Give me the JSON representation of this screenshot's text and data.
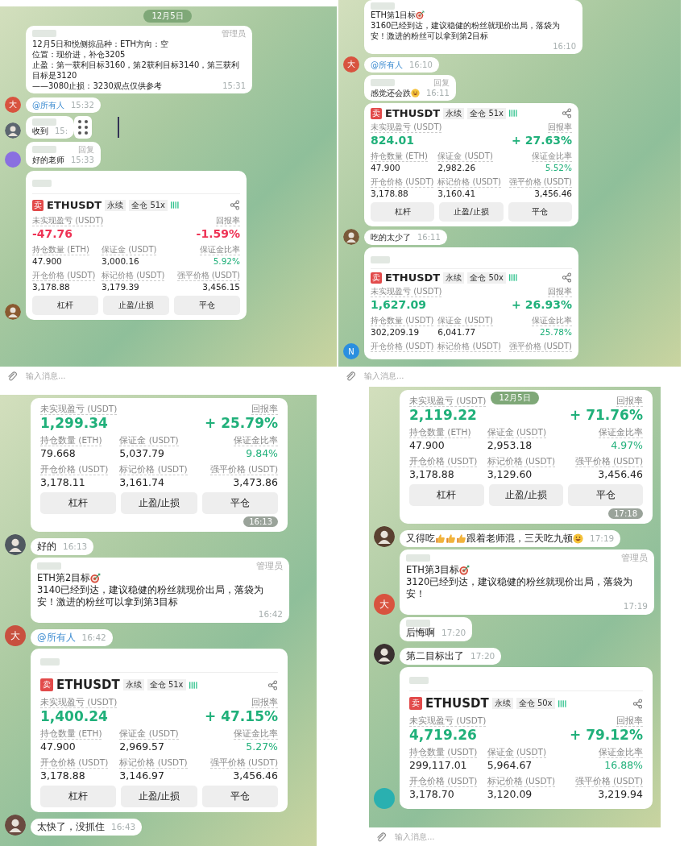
{
  "panels": [
    {
      "items": [
        {
          "kind": "date",
          "text": "12月5日"
        },
        {
          "kind": "message",
          "sender_hidden": true,
          "tag": "管理员",
          "paragraphs": [
            "12月5日和悦侧掠",
            "品种：ETH",
            "方向：空",
            "位置：现价进，补仓3205",
            "止盈：第一获利目标3160，第2获利目标3140，第三获利目标是3120",
            "——3080",
            "止损：3230",
            "观点仅供参考"
          ],
          "time": "15:31"
        },
        {
          "kind": "message",
          "avatar": {
            "kind": "letter",
            "text": "大",
            "color": "#d8533f"
          },
          "mention": true,
          "paragraphs": [
            "@所有人"
          ],
          "time": "15:32"
        },
        {
          "kind": "message",
          "avatar": {
            "kind": "photo",
            "color": "#5c6670"
          },
          "sender_hidden": true,
          "paragraphs": [
            "收到"
          ],
          "time": "15:",
          "handle": true
        },
        {
          "kind": "message",
          "avatar": {
            "kind": "plain",
            "color": "#8a6fe0"
          },
          "sender_hidden": true,
          "tag": "回复",
          "paragraphs": [
            "好的老师"
          ],
          "time": "15:33"
        },
        {
          "kind": "card",
          "avatar": {
            "kind": "photo",
            "color": "#8a5a30"
          },
          "name_hidden": true,
          "side": "卖",
          "symbol": "ETHUSDT",
          "tags": [
            "永续",
            "全仓 51x"
          ],
          "rows": [
            {
              "big": true,
              "cells": [
                {
                  "label": "未实现盈亏 (USDT)",
                  "value": "-47.76",
                  "color": "#ee3355"
                },
                null,
                {
                  "label": "回报率",
                  "value": "-1.59%",
                  "color": "#ee3355"
                }
              ]
            },
            {
              "cells": [
                {
                  "label": "持仓数量 (ETH)",
                  "value": "47.900"
                },
                {
                  "label": "保证金 (USDT)",
                  "value": "3,000.16"
                },
                {
                  "label": "保证金比率",
                  "value": "5.92%",
                  "color": "#20b07a"
                }
              ]
            },
            {
              "cells": [
                {
                  "label": "开仓价格 (USDT)",
                  "value": "3,178.88"
                },
                {
                  "label": "标记价格 (USDT)",
                  "value": "3,179.39"
                },
                {
                  "label": "强平价格 (USDT)",
                  "value": "3,456.15"
                }
              ]
            }
          ],
          "buttons": [
            "杠杆",
            "止盈/止损",
            "平仓"
          ]
        }
      ],
      "input": {
        "placeholder": "输入消息..."
      }
    },
    {
      "items": [
        {
          "kind": "message",
          "sender_hidden": true,
          "paragraphs": [
            [
              {
                "kind": "text",
                "text": "ETH第1目标"
              },
              {
                "kind": "target"
              },
              {
                "kind": "text",
                "text": "3160已经到达，建议稳健的粉丝就现价出局，落袋为安！激进的粉丝可以拿到第2目标"
              }
            ]
          ],
          "time": "16:10"
        },
        {
          "kind": "message",
          "avatar": {
            "kind": "letter",
            "text": "大",
            "color": "#d8533f"
          },
          "mention": true,
          "paragraphs": [
            "@所有人"
          ],
          "time": "16:10"
        },
        {
          "kind": "message",
          "sender_hidden": true,
          "tag": "回复",
          "paragraphs": [
            [
              {
                "kind": "text",
                "text": "感觉还会跌"
              },
              {
                "kind": "grin"
              }
            ]
          ],
          "time": "16:11"
        },
        {
          "kind": "card",
          "side": "卖",
          "symbol": "ETHUSDT",
          "tags": [
            "永续",
            "全仓 51x"
          ],
          "rows": [
            {
              "big": true,
              "cells": [
                {
                  "label": "未实现盈亏 (USDT)",
                  "value": "824.01",
                  "color": "#20b07a"
                },
                null,
                {
                  "label": "回报率",
                  "value": "+ 27.63%",
                  "color": "#20b07a"
                }
              ]
            },
            {
              "cells": [
                {
                  "label": "持仓数量 (ETH)",
                  "value": "47.900"
                },
                {
                  "label": "保证金 (USDT)",
                  "value": "2,982.26"
                },
                {
                  "label": "保证金比率",
                  "value": "5.52%",
                  "color": "#20b07a"
                }
              ]
            },
            {
              "cells": [
                {
                  "label": "开仓价格 (USDT)",
                  "value": "3,178.88"
                },
                {
                  "label": "标记价格 (USDT)",
                  "value": "3,160.41"
                },
                {
                  "label": "强平价格 (USDT)",
                  "value": "3,456.46"
                }
              ]
            }
          ],
          "buttons": [
            "杠杆",
            "止盈/止损",
            "平仓"
          ]
        },
        {
          "kind": "message",
          "avatar": {
            "kind": "photo",
            "color": "#7a5a3a"
          },
          "paragraphs": [
            "吃的太少了"
          ],
          "time": "16:11"
        },
        {
          "kind": "card",
          "avatar": {
            "kind": "letter",
            "text": "N",
            "color": "#2a8fe0"
          },
          "name_hidden": true,
          "side": "卖",
          "symbol": "ETHUSDT",
          "tags": [
            "永续",
            "全仓 50x"
          ],
          "rows": [
            {
              "big": true,
              "cells": [
                {
                  "label": "未实现盈亏 (USDT)",
                  "value": "1,627.09",
                  "color": "#20b07a"
                },
                null,
                {
                  "label": "回报率",
                  "value": "+ 26.93%",
                  "color": "#20b07a"
                }
              ]
            },
            {
              "cells": [
                {
                  "label": "持仓数量 (USDT)",
                  "value": "302,209.19"
                },
                {
                  "label": "保证金 (USDT)",
                  "value": "6,041.77"
                },
                {
                  "label": "保证金比率",
                  "value": "25.78%",
                  "color": "#20b07a"
                }
              ]
            },
            {
              "cells": [
                {
                  "label": "开仓价格 (USDT)"
                },
                {
                  "label": "标记价格 (USDT)"
                },
                {
                  "label": "强平价格 (USDT)"
                }
              ]
            }
          ]
        }
      ],
      "input": {
        "placeholder": "输入消息..."
      }
    },
    {
      "items": [
        {
          "kind": "card",
          "rows": [
            {
              "big": true,
              "cells": [
                {
                  "label": "未实现盈亏 (USDT)",
                  "value": "1,299.34",
                  "color": "#20b07a"
                },
                null,
                {
                  "label": "回报率",
                  "value": "+ 25.79%",
                  "color": "#20b07a"
                }
              ]
            },
            {
              "cells": [
                {
                  "label": "持仓数量 (ETH)",
                  "value": "79.668"
                },
                {
                  "label": "保证金 (USDT)",
                  "value": "5,037.79"
                },
                {
                  "label": "保证金比率",
                  "value": "9.84%",
                  "color": "#20b07a"
                }
              ]
            },
            {
              "cells": [
                {
                  "label": "开仓价格 (USDT)",
                  "value": "3,178.11"
                },
                {
                  "label": "标记价格 (USDT)",
                  "value": "3,161.74"
                },
                {
                  "label": "强平价格 (USDT)",
                  "value": "3,473.86"
                }
              ]
            }
          ],
          "buttons": [
            "杠杆",
            "止盈/止损",
            "平仓"
          ],
          "time": "16:13"
        },
        {
          "kind": "message",
          "avatar": {
            "kind": "photo",
            "color": "#505860"
          },
          "paragraphs": [
            "好的"
          ],
          "time": "16:13"
        },
        {
          "kind": "message",
          "sender_hidden": true,
          "tag": "管理员",
          "paragraphs": [
            [
              {
                "kind": "text",
                "text": "ETH第2目标"
              },
              {
                "kind": "target"
              },
              {
                "kind": "text",
                "text": "3140已经到达，建议稳健的粉丝就现价出局，落袋为安！激进的粉丝可以拿到第3目标"
              }
            ]
          ],
          "time": "16:42"
        },
        {
          "kind": "message",
          "avatar": {
            "kind": "letter",
            "text": "大",
            "color": "#c8503f"
          },
          "mention": true,
          "paragraphs": [
            "@所有人"
          ],
          "time": "16:42"
        },
        {
          "kind": "card",
          "name_hidden": true,
          "side": "卖",
          "symbol": "ETHUSDT",
          "tags": [
            "永续",
            "全仓 51x"
          ],
          "rows": [
            {
              "big": true,
              "cells": [
                {
                  "label": "未实现盈亏 (USDT)",
                  "value": "1,400.24",
                  "color": "#20b07a"
                },
                null,
                {
                  "label": "回报率",
                  "value": "+ 47.15%",
                  "color": "#20b07a"
                }
              ]
            },
            {
              "cells": [
                {
                  "label": "持仓数量 (ETH)",
                  "value": "47.900"
                },
                {
                  "label": "保证金 (USDT)",
                  "value": "2,969.57"
                },
                {
                  "label": "保证金比率",
                  "value": "5.27%",
                  "color": "#20b07a"
                }
              ]
            },
            {
              "cells": [
                {
                  "label": "开仓价格 (USDT)",
                  "value": "3,178.88"
                },
                {
                  "label": "标记价格 (USDT)",
                  "value": "3,146.97"
                },
                {
                  "label": "强平价格 (USDT)",
                  "value": "3,456.46"
                }
              ]
            }
          ],
          "buttons": [
            "杠杆",
            "止盈/止损",
            "平仓"
          ]
        },
        {
          "kind": "message",
          "avatar": {
            "kind": "photo",
            "color": "#6a4a40"
          },
          "paragraphs": [
            "太快了，没抓住"
          ],
          "time": "16:43"
        }
      ]
    },
    {
      "items": [
        {
          "kind": "date",
          "text": "12月5日",
          "floating": true
        },
        {
          "kind": "card",
          "rows": [
            {
              "big": true,
              "cells": [
                {
                  "label": "未实现盈亏 (USDT)",
                  "value": "2,119.22",
                  "color": "#20b07a"
                },
                null,
                {
                  "label": "回报率",
                  "value": "+ 71.76%",
                  "color": "#20b07a"
                }
              ]
            },
            {
              "cells": [
                {
                  "label": "持仓数量 (ETH)",
                  "value": "47.900"
                },
                {
                  "label": "保证金 (USDT)",
                  "value": "2,953.18"
                },
                {
                  "label": "保证金比率",
                  "value": "4.97%",
                  "color": "#20b07a"
                }
              ]
            },
            {
              "cells": [
                {
                  "label": "开仓价格 (USDT)",
                  "value": "3,178.88"
                },
                {
                  "label": "标记价格 (USDT)",
                  "value": "3,129.60"
                },
                {
                  "label": "强平价格 (USDT)",
                  "value": "3,456.46"
                }
              ]
            }
          ],
          "buttons": [
            "杠杆",
            "止盈/止损",
            "平仓"
          ],
          "time": "17:18"
        },
        {
          "kind": "message",
          "avatar": {
            "kind": "photo",
            "color": "#5a4030"
          },
          "paragraphs": [
            [
              {
                "kind": "text",
                "text": "又得吃"
              },
              {
                "kind": "thumb"
              },
              {
                "kind": "thumb"
              },
              {
                "kind": "thumb"
              },
              {
                "kind": "text",
                "text": "跟着老师混，三天吃九顿"
              },
              {
                "kind": "grin"
              }
            ]
          ],
          "time": "17:19"
        },
        {
          "kind": "message",
          "avatar": {
            "kind": "letter",
            "text": "大",
            "color": "#d8533f"
          },
          "sender_hidden": true,
          "tag": "管理员",
          "paragraphs": [
            [
              {
                "kind": "text",
                "text": "ETH第3目标"
              },
              {
                "kind": "target"
              },
              {
                "kind": "text",
                "text": "3120已经到达，建议稳健的粉丝就现价出局，落袋为安！"
              }
            ]
          ],
          "time": "17:19"
        },
        {
          "kind": "message",
          "sender_hidden": true,
          "paragraphs": [
            "后悔啊"
          ],
          "time": "17:20"
        },
        {
          "kind": "message",
          "avatar": {
            "kind": "photo",
            "color": "#3a3030"
          },
          "paragraphs": [
            "第二目标出了"
          ],
          "time": "17:20"
        },
        {
          "kind": "card",
          "avatar": {
            "kind": "plain",
            "color": "#2ab0b0"
          },
          "name_hidden": true,
          "side": "卖",
          "symbol": "ETHUSDT",
          "tags": [
            "永续",
            "全仓 50x"
          ],
          "rows": [
            {
              "big": true,
              "cells": [
                {
                  "label": "未实现盈亏 (USDT)",
                  "value": "4,719.26",
                  "color": "#20b07a"
                },
                null,
                {
                  "label": "回报率",
                  "value": "+ 79.12%",
                  "color": "#20b07a"
                }
              ]
            },
            {
              "cells": [
                {
                  "label": "持仓数量 (USDT)",
                  "value": "299,117.01"
                },
                {
                  "label": "保证金 (USDT)",
                  "value": "5,964.67"
                },
                {
                  "label": "保证金比率",
                  "value": "16.88%",
                  "color": "#20b07a"
                }
              ]
            },
            {
              "cells": [
                {
                  "label": "开仓价格 (USDT)",
                  "value": "3,178.70"
                },
                {
                  "label": "标记价格 (USDT)",
                  "value": "3,120.09"
                },
                {
                  "label": "强平价格 (USDT)",
                  "value": "3,219.94"
                }
              ]
            }
          ]
        }
      ],
      "input": {
        "placeholder": "输入消息..."
      }
    }
  ]
}
